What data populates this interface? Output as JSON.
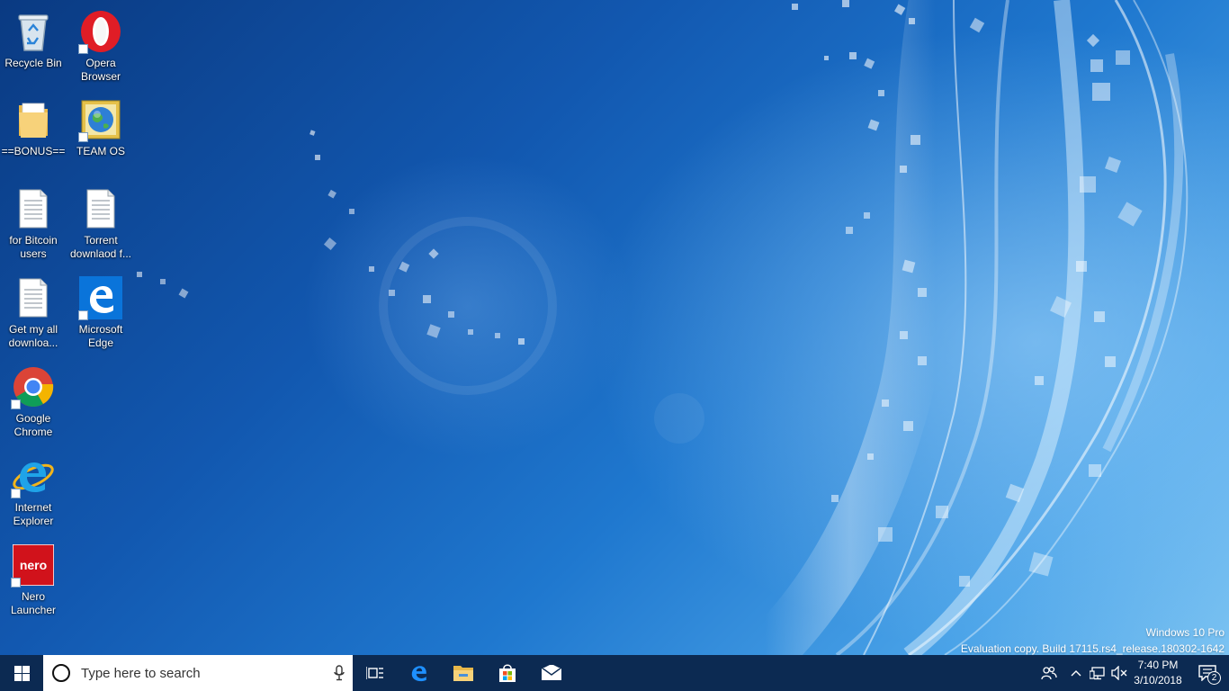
{
  "desktop": {
    "icons": [
      {
        "id": "recycle-bin",
        "label": "Recycle Bin",
        "icon": "recycle-bin-icon",
        "shortcut": false
      },
      {
        "id": "opera-browser",
        "label": "Opera Browser",
        "icon": "opera-icon",
        "shortcut": true
      },
      {
        "id": "bonus-folder",
        "label": "==BONUS==",
        "icon": "folder-icon",
        "shortcut": false
      },
      {
        "id": "team-os",
        "label": "TEAM OS",
        "icon": "globe-icon",
        "shortcut": true
      },
      {
        "id": "for-bitcoin-users",
        "label": "for Bitcoin users",
        "icon": "text-document-icon",
        "shortcut": false
      },
      {
        "id": "torrent-download",
        "label": "Torrent downlaod f...",
        "icon": "text-document-icon",
        "shortcut": false
      },
      {
        "id": "get-my-all-downloads",
        "label": "Get my all downloa...",
        "icon": "text-document-icon",
        "shortcut": false
      },
      {
        "id": "microsoft-edge",
        "label": "Microsoft Edge",
        "icon": "edge-icon",
        "shortcut": true
      },
      {
        "id": "google-chrome",
        "label": "Google Chrome",
        "icon": "chrome-icon",
        "shortcut": true
      },
      {
        "id": "internet-explorer",
        "label": "Internet Explorer",
        "icon": "internet-explorer-icon",
        "shortcut": true
      },
      {
        "id": "nero-launcher",
        "label": "Nero Launcher",
        "icon": "nero-icon",
        "shortcut": true
      }
    ]
  },
  "watermark": {
    "line1": "Windows 10 Pro",
    "line2": "Evaluation copy. Build 17115.rs4_release.180302-1642"
  },
  "taskbar": {
    "search_placeholder": "Type here to search",
    "apps": [
      "task-view-icon",
      "edge-icon",
      "file-explorer-icon",
      "store-icon",
      "mail-icon"
    ],
    "tray": [
      "people-icon",
      "chevron-up-icon",
      "network-icon",
      "volume-muted-icon"
    ],
    "clock_time": "7:40 PM",
    "clock_date": "3/10/2018",
    "notification_count": "2"
  },
  "colors": {
    "taskbar": "#0c2a52",
    "desktop_dark": "#0a3a82",
    "desktop_light": "#7cc3f2",
    "opera_red": "#e01d26",
    "edge_blue": "#0a74da",
    "nero_red": "#d1121b"
  }
}
